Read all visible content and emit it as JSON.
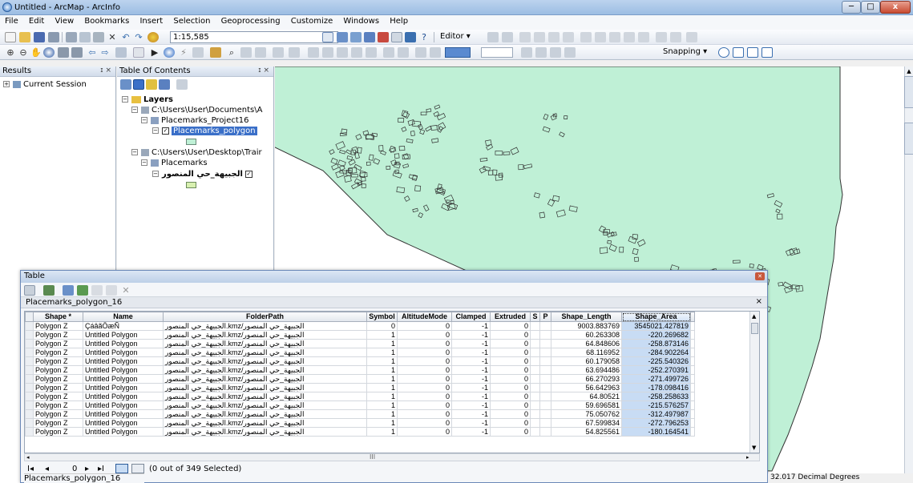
{
  "window": {
    "title": "Untitled - ArcMap - ArcInfo",
    "min": "─",
    "max": "□",
    "close": "x"
  },
  "menu": [
    "File",
    "Edit",
    "View",
    "Bookmarks",
    "Insert",
    "Selection",
    "Geoprocessing",
    "Customize",
    "Windows",
    "Help"
  ],
  "toolbar": {
    "scale": "1:15,585",
    "editor": "Editor ▾",
    "snapping": "Snapping ▾"
  },
  "results": {
    "title": "Results",
    "close": "ɪ ×",
    "item": "Current Session"
  },
  "toc": {
    "title": "Table Of Contents",
    "close": "ɪ ×",
    "layers": "Layers",
    "path1": "C:\\Users\\User\\Documents\\A",
    "group1": "Placemarks_Project16",
    "layer1": "Placemarks_polygon",
    "path2": "C:\\Users\\User\\Desktop\\Trair",
    "group2": "Placemarks",
    "layer2": "الجبيهة_حي المنصور"
  },
  "table": {
    "window_title": "Table",
    "layer_name": "Placemarks_polygon_16",
    "close": "×",
    "headers": [
      "Shape *",
      "Name",
      "FolderPath",
      "Symbol",
      "AltitudeMode",
      "Clamped",
      "Extruded",
      "S",
      "P",
      "Shape_Length",
      "Shape_Area"
    ],
    "rows": [
      [
        "Polygon Z",
        "ÇáâãÖæÑ",
        "الجبيهة_حي المنصور/kmz.الجبيهة_حي المنصور",
        "0",
        "0",
        "-1",
        "0",
        "",
        "",
        "9003.883769",
        "3545021.427819"
      ],
      [
        "Polygon Z",
        "Untitled Polygon",
        "الجبيهة_حي المنصور/kmz.الجبيهة_حي المنصور",
        "1",
        "0",
        "-1",
        "0",
        "",
        "",
        "60.263308",
        "-220.269682"
      ],
      [
        "Polygon Z",
        "Untitled Polygon",
        "الجبيهة_حي المنصور/kmz.الجبيهة_حي المنصور",
        "1",
        "0",
        "-1",
        "0",
        "",
        "",
        "64.848606",
        "-258.873146"
      ],
      [
        "Polygon Z",
        "Untitled Polygon",
        "الجبيهة_حي المنصور/kmz.الجبيهة_حي المنصور",
        "1",
        "0",
        "-1",
        "0",
        "",
        "",
        "68.116952",
        "-284.902264"
      ],
      [
        "Polygon Z",
        "Untitled Polygon",
        "الجبيهة_حي المنصور/kmz.الجبيهة_حي المنصور",
        "1",
        "0",
        "-1",
        "0",
        "",
        "",
        "60.179058",
        "-225.540326"
      ],
      [
        "Polygon Z",
        "Untitled Polygon",
        "الجبيهة_حي المنصور/kmz.الجبيهة_حي المنصور",
        "1",
        "0",
        "-1",
        "0",
        "",
        "",
        "63.694486",
        "-252.270391"
      ],
      [
        "Polygon Z",
        "Untitled Polygon",
        "الجبيهة_حي المنصور/kmz.الجبيهة_حي المنصور",
        "1",
        "0",
        "-1",
        "0",
        "",
        "",
        "66.270293",
        "-271.499726"
      ],
      [
        "Polygon Z",
        "Untitled Polygon",
        "الجبيهة_حي المنصور/kmz.الجبيهة_حي المنصور",
        "1",
        "0",
        "-1",
        "0",
        "",
        "",
        "56.642963",
        "-178.098416"
      ],
      [
        "Polygon Z",
        "Untitled Polygon",
        "الجبيهة_حي المنصور/kmz.الجبيهة_حي المنصور",
        "1",
        "0",
        "-1",
        "0",
        "",
        "",
        "64.80521",
        "-258.258633"
      ],
      [
        "Polygon Z",
        "Untitled Polygon",
        "الجبيهة_حي المنصور/kmz.الجبيهة_حي المنصور",
        "1",
        "0",
        "-1",
        "0",
        "",
        "",
        "59.696581",
        "-215.576257"
      ],
      [
        "Polygon Z",
        "Untitled Polygon",
        "الجبيهة_حي المنصور/kmz.الجبيهة_حي المنصور",
        "1",
        "0",
        "-1",
        "0",
        "",
        "",
        "75.050762",
        "-312.497987"
      ],
      [
        "Polygon Z",
        "Untitled Polygon",
        "الجبيهة_حي المنصور/kmz.الجبيهة_حي المنصور",
        "1",
        "0",
        "-1",
        "0",
        "",
        "",
        "67.599834",
        "-272.796253"
      ],
      [
        "Polygon Z",
        "Untitled Polygon",
        "الجبيهة_حي المنصور/kmz.الجبيهة_حي المنصور",
        "1",
        "0",
        "-1",
        "0",
        "",
        "",
        "54.825561",
        "-180.164541"
      ]
    ],
    "nav_first": "I◂",
    "nav_prev": "◂",
    "nav_record": "0",
    "nav_next": "▸",
    "nav_last": "▸I",
    "selection_status": "(0 out of 349 Selected)",
    "footer_tab": "Placemarks_polygon_16"
  },
  "status": {
    "coords": "32.017 Decimal Degrees"
  },
  "colors": {
    "polygon_fill": "#bff0d6",
    "polygon_stroke": "#333333",
    "accent": "#3a6fb0"
  }
}
